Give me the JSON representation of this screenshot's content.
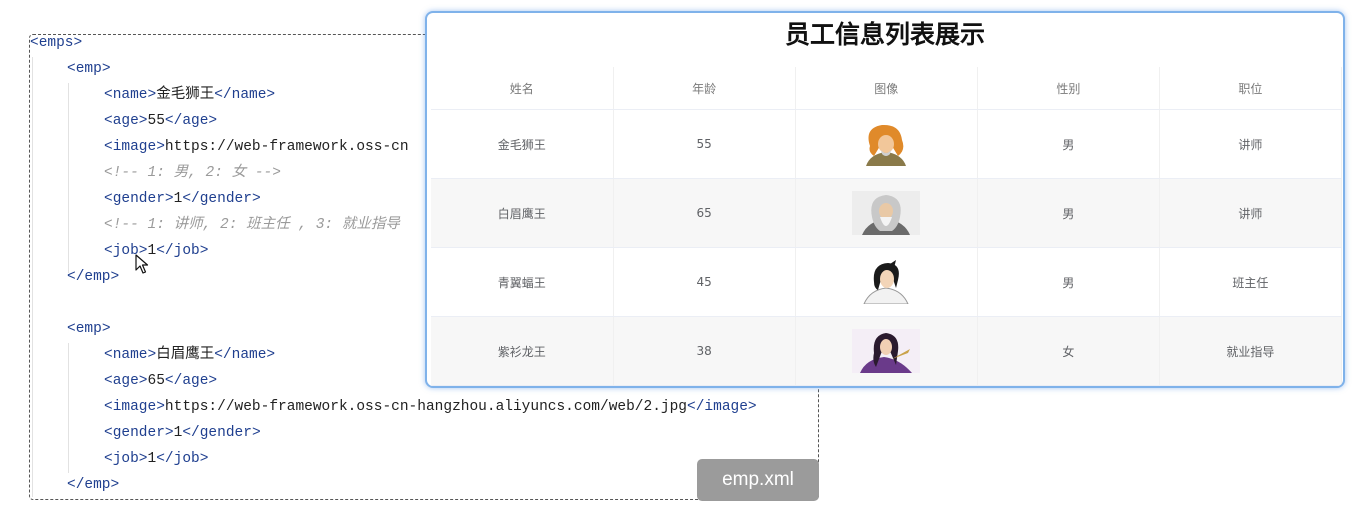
{
  "code": {
    "filename": "emp.xml",
    "emps_open": "emps",
    "records": [
      {
        "emp_tag": "emp",
        "name": "金毛狮王",
        "age": "55",
        "image_visible": "https://web-framework.oss-cn",
        "gender_comment": "<!-- 1: 男, 2: 女 -->",
        "gender": "1",
        "job_comment": "<!-- 1: 讲师, 2: 班主任 , 3: 就业指导",
        "job": "1"
      },
      {
        "emp_tag": "emp",
        "name": "白眉鹰王",
        "age": "65",
        "image_visible": "https://web-framework.oss-cn-hangzhou.aliyuncs.com/web/2.jpg",
        "gender": "1",
        "job": "1"
      }
    ]
  },
  "table": {
    "title": "员工信息列表展示",
    "headers": [
      "姓名",
      "年龄",
      "图像",
      "性别",
      "职位"
    ],
    "rows": [
      {
        "name": "金毛狮王",
        "age": "55",
        "avatar": "golden-hair-character-avatar",
        "gender": "男",
        "job": "讲师"
      },
      {
        "name": "白眉鹰王",
        "age": "65",
        "avatar": "white-brow-character-avatar",
        "gender": "男",
        "job": "讲师"
      },
      {
        "name": "青翼蝠王",
        "age": "45",
        "avatar": "green-wing-character-avatar",
        "gender": "男",
        "job": "班主任"
      },
      {
        "name": "紫衫龙王",
        "age": "38",
        "avatar": "purple-robe-character-avatar",
        "gender": "女",
        "job": "就业指导"
      }
    ]
  },
  "colors": {
    "xml_tag": "#1f3f8f",
    "comment": "#9a9a9a",
    "card_border": "#7fb2ea",
    "badge_bg": "#9b9b9b",
    "stripe": "#f7f7f7"
  }
}
